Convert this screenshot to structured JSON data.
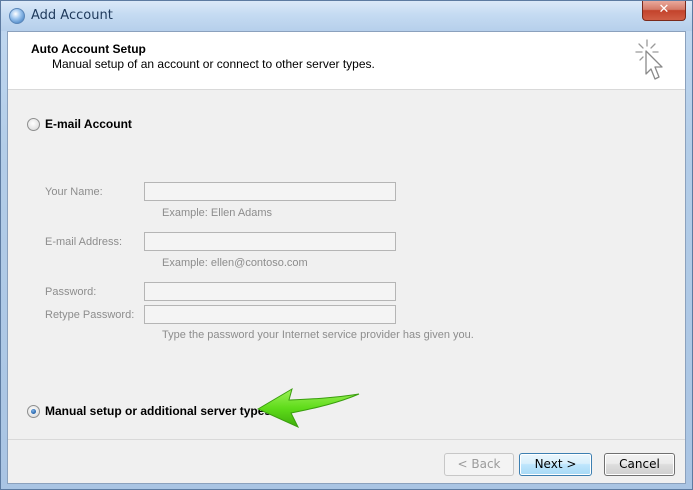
{
  "window": {
    "title": "Add Account",
    "close_glyph": "✕"
  },
  "header": {
    "title": "Auto Account Setup",
    "subtitle": "Manual setup of an account or connect to other server types.",
    "icon": "cursor-sparkle-icon"
  },
  "options": {
    "email_account": {
      "label": "E-mail Account",
      "selected": false
    },
    "manual_setup": {
      "label": "Manual setup or additional server types",
      "selected": true
    }
  },
  "form": {
    "your_name": {
      "label": "Your Name:",
      "value": "",
      "hint": "Example: Ellen Adams"
    },
    "email_address": {
      "label": "E-mail Address:",
      "value": "",
      "hint": "Example: ellen@contoso.com"
    },
    "password": {
      "label": "Password:",
      "value": ""
    },
    "retype_password": {
      "label": "Retype Password:",
      "value": "",
      "hint": "Type the password your Internet service provider has given you."
    }
  },
  "buttons": {
    "back": "< Back",
    "next": "Next >",
    "cancel": "Cancel"
  },
  "colors": {
    "highlight_arrow": "#5fdc1a",
    "window_frame": "#b6cfeb",
    "dialog_background": "#f0f0f0"
  }
}
